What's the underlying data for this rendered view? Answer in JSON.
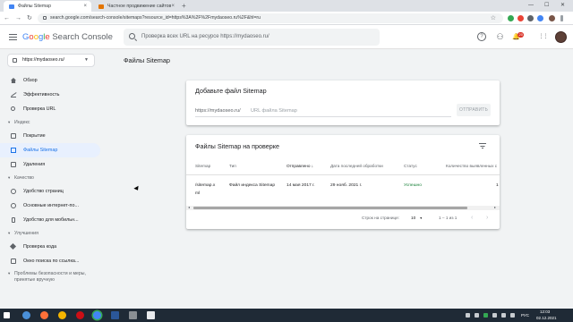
{
  "browser": {
    "tabs": [
      {
        "label": "Файлы Sitemap",
        "close": "×"
      },
      {
        "label": "Частное продвижение сайтов",
        "close": "×"
      }
    ],
    "new_tab": "+",
    "window_controls": {
      "minimize": "—",
      "maximize": "☐",
      "close": "✕"
    },
    "nav": {
      "back": "←",
      "forward": "→",
      "reload": "↻"
    },
    "url": "search.google.com/search-console/sitemaps?resource_id=https%3A%2F%2Fmydaoseo.ru%2F&hl=ru",
    "star": "☆"
  },
  "header": {
    "logo_google": [
      "G",
      "o",
      "o",
      "g",
      "l",
      "e"
    ],
    "logo_product": "Search Console",
    "search_placeholder": "Проверка всех URL на ресурсе https://mydaoseo.ru/",
    "help_icon": "?",
    "users_icon": "⚇",
    "bell_icon": "🔔",
    "notifications_count": "20",
    "apps_icon": "⋮⋮"
  },
  "property": {
    "url": "https://mydaoseo.ru/",
    "caret": "▼"
  },
  "page_title": "Файлы Sitemap",
  "sidebar": {
    "items_top": [
      {
        "label": "Обзор",
        "icon": "home-icon"
      },
      {
        "label": "Эффективность",
        "icon": "trend-icon"
      },
      {
        "label": "Проверка URL",
        "icon": "search-icon"
      }
    ],
    "sections": [
      {
        "title": "Индекс",
        "items": [
          {
            "label": "Покрытие",
            "icon": "file-icon"
          },
          {
            "label": "Файлы Sitemap",
            "icon": "sitemap-icon",
            "active": true
          },
          {
            "label": "Удаления",
            "icon": "remove-icon"
          }
        ]
      },
      {
        "title": "Качество",
        "items": [
          {
            "label": "Удобство страниц",
            "icon": "speed-icon"
          },
          {
            "label": "Основные интернет-по...",
            "icon": "speed-icon"
          },
          {
            "label": "Удобство для мобильн...",
            "icon": "phone-icon"
          }
        ]
      },
      {
        "title": "Улучшения",
        "items": [
          {
            "label": "Проверка кода",
            "icon": "diamond-icon"
          },
          {
            "label": "Окно поиска по ссылка...",
            "icon": "window-icon"
          }
        ]
      },
      {
        "title": "Проблемы безопасности и меры, принятые вручную",
        "items": []
      }
    ],
    "caret": "▾"
  },
  "add_sitemap": {
    "title": "Добавьте файл Sitemap",
    "prefix": "https://mydaoseo.ru/",
    "placeholder": "URL файла Sitemap",
    "submit": "ОТПРАВИТЬ"
  },
  "sitemaps_table": {
    "title": "Файлы Sitemap на проверке",
    "columns": [
      "Sitemap",
      "Тип",
      "Отправлено",
      "Дата последней обработки",
      "Статус",
      "Количество выявленных с"
    ],
    "sort_arrow": "↓",
    "rows": [
      {
        "sitemap_line1": "/sitemap.x",
        "sitemap_line2": "ml",
        "type": "Файл индекса Sitemap",
        "submitted": "14 мая 2017 г.",
        "last_read": "29 нояб. 2021 г.",
        "status": "Успешно",
        "discovered": "1"
      }
    ],
    "scroll_left": "◂",
    "scroll_right": "▸",
    "rows_per_page_label": "Строк на странице:",
    "rows_per_page": "10",
    "rows_caret": "▼",
    "range": "1 – 1 из 1",
    "prev": "‹",
    "next": "›"
  },
  "taskbar": {
    "lang": "РУС",
    "time": "12:03",
    "date": "02.12.2021"
  },
  "colors": {
    "accent": "#1a73e8",
    "success": "#188038",
    "badge": "#d93025"
  }
}
